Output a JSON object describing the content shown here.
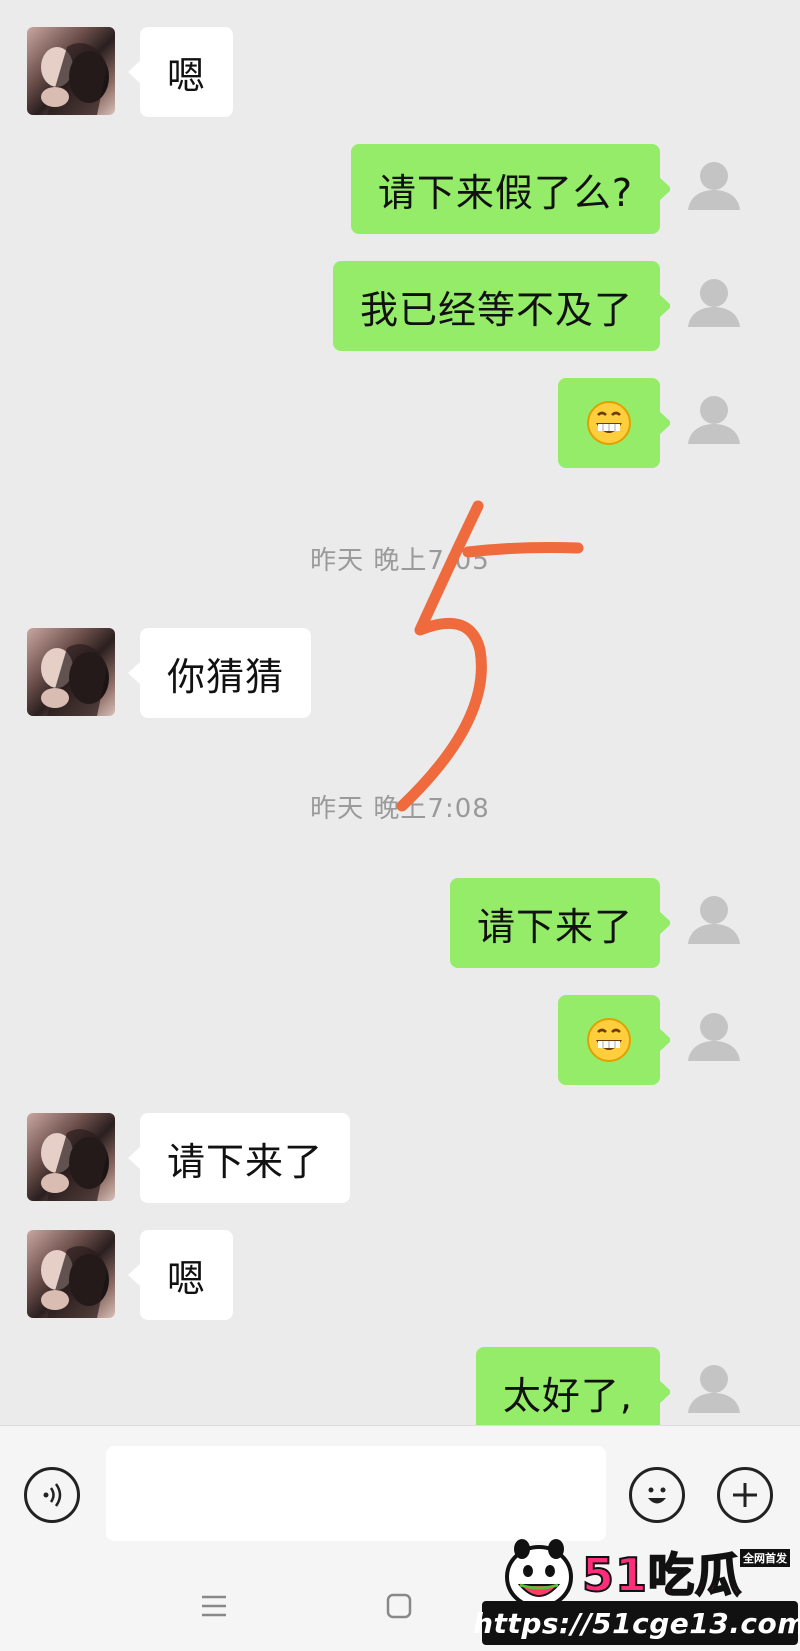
{
  "messages": [
    {
      "side": "left",
      "text": "嗯"
    },
    {
      "side": "right",
      "text": "请下来假了么?"
    },
    {
      "side": "right",
      "text": "我已经等不及了"
    },
    {
      "side": "right",
      "emoji": "grin-emoji"
    },
    {
      "time": "昨天 晚上7:05"
    },
    {
      "side": "left",
      "text": "你猜猜"
    },
    {
      "time": "昨天 晚上7:08"
    },
    {
      "side": "right",
      "text": "请下来了"
    },
    {
      "side": "right",
      "emoji": "grin-emoji"
    },
    {
      "side": "left",
      "text": "请下来了"
    },
    {
      "side": "left",
      "text": "嗯"
    },
    {
      "side": "right",
      "text": "太好了,"
    }
  ],
  "annotation": {
    "text": "5",
    "color": "#ef6a3c"
  },
  "input_bar": {
    "voice_icon": "voice-icon",
    "emoji_icon": "smiley-icon",
    "plus_icon": "plus-icon"
  },
  "watermark": {
    "brand": "51吃瓜",
    "tag": "全网首发",
    "url": "https://51cge13.com"
  },
  "colors": {
    "self_bubble": "#95ec69",
    "peer_bubble": "#ffffff",
    "background": "#ebebeb",
    "time_text": "#9a9a9a"
  }
}
